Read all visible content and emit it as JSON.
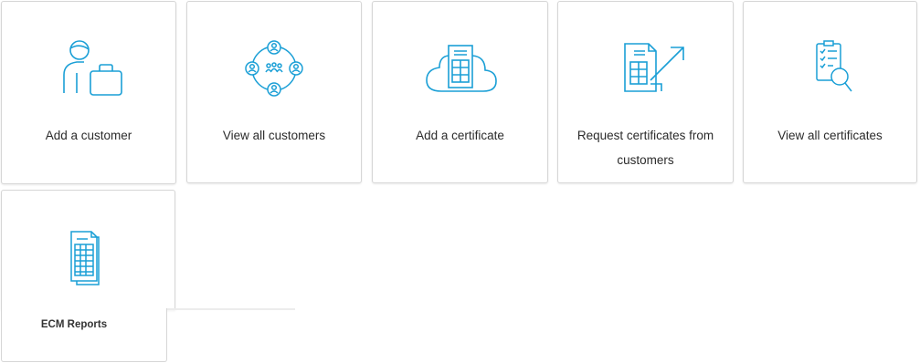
{
  "tiles": [
    {
      "label": "Add a customer",
      "icon": "add-customer-icon"
    },
    {
      "label": "View all customers",
      "icon": "customer-network-icon"
    },
    {
      "label": "Add a certificate",
      "icon": "cloud-certificate-icon"
    },
    {
      "label": "Request certificates from customers",
      "icon": "request-certificate-icon"
    },
    {
      "label": "View all certificates",
      "icon": "certificate-search-icon"
    },
    {
      "label": "ECM Reports",
      "icon": "reports-stack-icon"
    }
  ],
  "colors": {
    "icon": "#1a9fd6",
    "text": "#2b2b2b",
    "border": "#d6d6d6"
  }
}
